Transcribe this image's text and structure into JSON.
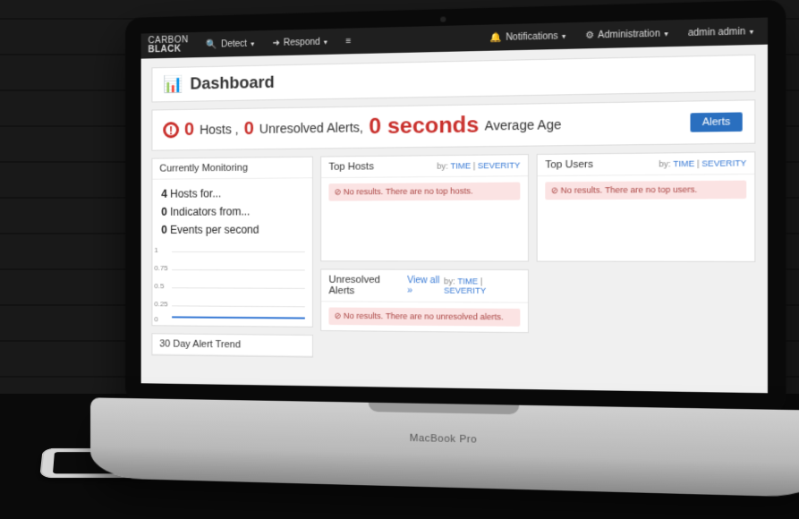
{
  "brand": {
    "line1": "CARBON",
    "line2": "BLACK"
  },
  "nav": {
    "detect": "Detect",
    "respond": "Respond",
    "notifications": "Notifications",
    "administration": "Administration",
    "user": "admin admin"
  },
  "page": {
    "title": "Dashboard"
  },
  "summary": {
    "hosts_count": "0",
    "hosts_label": "Hosts ,",
    "unresolved_count": "0",
    "unresolved_label": "Unresolved Alerts,",
    "age_value": "0 seconds",
    "age_label": "Average Age",
    "alerts_button": "Alerts"
  },
  "by_label": "by:",
  "by_time": "TIME",
  "by_severity": "SEVERITY",
  "panels": {
    "monitoring": {
      "title": "Currently Monitoring",
      "hosts_count": "4",
      "hosts_label": "Hosts for...",
      "indicators_count": "0",
      "indicators_label": "Indicators from...",
      "events_count": "0",
      "events_label": "Events per second"
    },
    "trend": {
      "title": "30 Day Alert Trend"
    },
    "top_hosts": {
      "title": "Top Hosts",
      "empty": "No results. There are no top hosts."
    },
    "top_users": {
      "title": "Top Users",
      "empty": "No results. There are no top users."
    },
    "unresolved": {
      "title": "Unresolved Alerts",
      "view_all": "View all »",
      "empty": "No results. There are no unresolved alerts."
    }
  },
  "chart_data": {
    "type": "line",
    "title": "Events per second",
    "xlabel": "",
    "ylabel": "",
    "ylim": [
      0,
      1.0
    ],
    "yticks": [
      0.0,
      0.25,
      0.5,
      0.75,
      1.0
    ],
    "x": [],
    "series": [
      {
        "name": "events/s",
        "values": []
      }
    ]
  },
  "laptop_label": "MacBook Pro"
}
